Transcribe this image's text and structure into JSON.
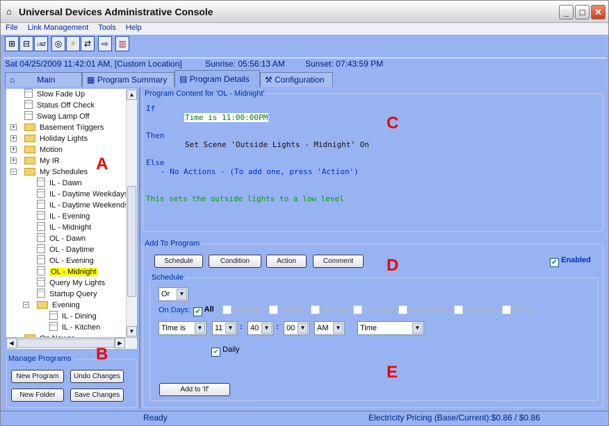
{
  "window": {
    "title": "Universal Devices Administrative Console"
  },
  "menu": [
    "File",
    "Link Management",
    "Tools",
    "Help"
  ],
  "toolbar": [
    "expand-all",
    "collapse-all",
    "sort-az",
    "scenes",
    "light",
    "swap",
    "export",
    "chart"
  ],
  "info": {
    "datetime": "Sat 04/25/2009 11:42:01 AM,  [Custom Location]",
    "sunrise": "Sunrise: 05:56:13 AM",
    "sunset": "Sunset: 07:43:59 PM"
  },
  "tabs": [
    "Main",
    "Program Summary",
    "Program Details",
    "Configuration"
  ],
  "tree": [
    {
      "label": "Slow Fade Up",
      "type": "doc",
      "level": 1
    },
    {
      "label": "Status Off Check",
      "type": "doc",
      "level": 1
    },
    {
      "label": "Swag Lamp Off",
      "type": "doc",
      "level": 1
    },
    {
      "label": "Basement Triggers",
      "type": "folder",
      "level": 1,
      "expander": "+"
    },
    {
      "label": "Holiday Lights",
      "type": "folder",
      "level": 1,
      "expander": "+"
    },
    {
      "label": "Motion",
      "type": "folder",
      "level": 1,
      "expander": "+"
    },
    {
      "label": "My IR",
      "type": "folder",
      "level": 1,
      "expander": "+"
    },
    {
      "label": "My Schedules",
      "type": "folder",
      "level": 1,
      "expander": "-"
    },
    {
      "label": "IL - Dawn",
      "type": "doc",
      "level": 2
    },
    {
      "label": "IL - Daytime Weekdays",
      "type": "doc",
      "level": 2
    },
    {
      "label": "IL - Daytime Weekends",
      "type": "doc",
      "level": 2
    },
    {
      "label": "IL - Evening",
      "type": "doc",
      "level": 2
    },
    {
      "label": "IL - Midnight",
      "type": "doc",
      "level": 2
    },
    {
      "label": "OL - Dawn",
      "type": "doc",
      "level": 2
    },
    {
      "label": "OL - Daytime",
      "type": "doc",
      "level": 2
    },
    {
      "label": "OL - Evening",
      "type": "doc",
      "level": 2
    },
    {
      "label": "OL - Midnight",
      "type": "doc",
      "level": 2,
      "selected": true
    },
    {
      "label": "Query My Lights",
      "type": "doc",
      "level": 2
    },
    {
      "label": "Startup Query",
      "type": "doc",
      "level": 2
    },
    {
      "label": "Evening",
      "type": "folder",
      "level": 2,
      "expander": "-"
    },
    {
      "label": "IL - Dining",
      "type": "doc",
      "level": 3
    },
    {
      "label": "IL - Kitchen",
      "type": "doc",
      "level": 3
    },
    {
      "label": "On Newer",
      "type": "folder",
      "level": 1
    }
  ],
  "manage": {
    "title": "Manage Programs",
    "new_program": "New Program",
    "undo": "Undo Changes",
    "new_folder": "New Folder",
    "save": "Save Changes"
  },
  "content": {
    "title": "Program Content for 'OL - Midnight'",
    "if": "If",
    "if_line": "Time is 11:00:00PM",
    "then": "Then",
    "then_line": "Set Scene 'Outside Lights - Midnight' On",
    "else": "Else",
    "else_line": "- No Actions - (To add one, press 'Action')",
    "comment": "This sets the outside lights to a low level"
  },
  "add": {
    "title": "Add To Program",
    "schedule": "Schedule",
    "condition": "Condition",
    "action": "Action",
    "comment": "Comment",
    "enabled": "Enabled",
    "enabled_checked": true
  },
  "schedule": {
    "title": "Schedule",
    "logic": "Or",
    "on_days": "On Days:",
    "all": "All",
    "all_checked": true,
    "days": [
      "Saturday",
      "Sunday",
      "Monday",
      "Tuesday",
      "Wednesday",
      "Thursday",
      "Friday"
    ],
    "type": "Time is",
    "hour": "11",
    "minute": "40",
    "second": "00",
    "ampm": "AM",
    "mode": "Time",
    "daily": "Daily",
    "daily_checked": true,
    "add_button": "Add to 'If'"
  },
  "annotations": [
    "A",
    "B",
    "C",
    "D",
    "E"
  ],
  "status": {
    "state": "Ready",
    "pricing": "Electricity Pricing (Base/Current):$0.86 / $0.86"
  },
  "colors": {
    "background": "#98b3f2",
    "link": "#0026a0",
    "selection": "#ffff00",
    "comment": "#00a000"
  }
}
